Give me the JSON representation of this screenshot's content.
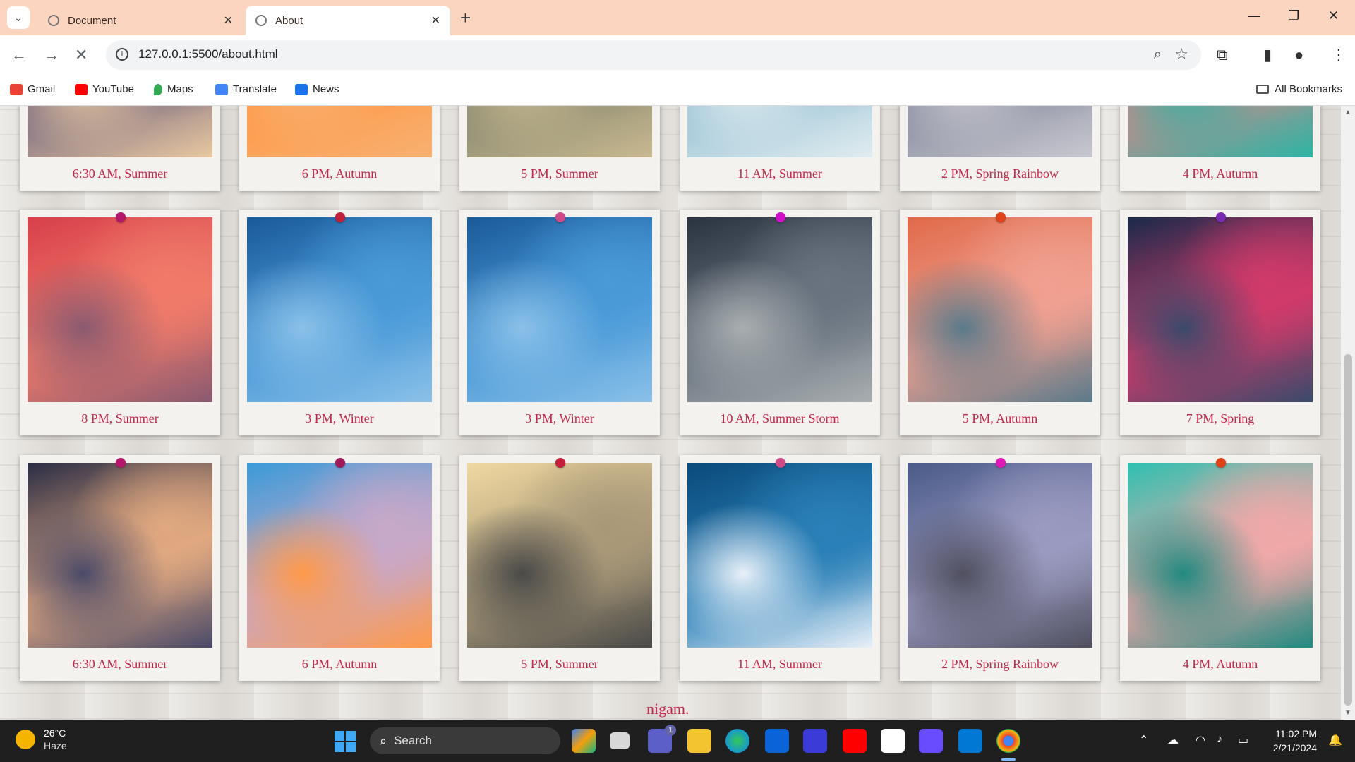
{
  "browser": {
    "tabs": [
      {
        "title": "Document"
      },
      {
        "title": "About"
      }
    ],
    "new_tab_label": "+",
    "address": "127.0.0.1:5500/about.html",
    "bookmarks": [
      {
        "label": "Gmail",
        "color": "#ea4335"
      },
      {
        "label": "YouTube",
        "color": "#ff0000"
      },
      {
        "label": "Maps",
        "color": "#34a853"
      },
      {
        "label": "Translate",
        "color": "#4285f4"
      },
      {
        "label": "News",
        "color": "#1a73e8"
      }
    ],
    "all_bookmarks_label": "All Bookmarks"
  },
  "gallery": {
    "caption_color": "#c0284a",
    "cards": [
      {
        "caption": "6:30 AM, Summer",
        "pin": "#b5186a",
        "sky": [
          "#2a2d45",
          "#7a6a80",
          "#e8c8a0"
        ]
      },
      {
        "caption": "6 PM, Autumn",
        "pin": "#a0195a",
        "sky": [
          "#d88a7a",
          "#ff9a4a",
          "#f7b070"
        ]
      },
      {
        "caption": "5 PM, Summer",
        "pin": "#c41e3a",
        "sky": [
          "#3a4048",
          "#8a8a70",
          "#c8b890"
        ]
      },
      {
        "caption": "11 AM, Summer",
        "pin": "#d04a8a",
        "sky": [
          "#2d6a8e",
          "#9cc4d6",
          "#e0ecf0"
        ]
      },
      {
        "caption": "2 PM, Spring Rainbow",
        "pin": "#e01ab8",
        "sky": [
          "#5a6078",
          "#8a8ea0",
          "#c8c8d0"
        ]
      },
      {
        "caption": "4 PM, Autumn",
        "pin": "#e0421a",
        "sky": [
          "#3aa090",
          "#c88a8a",
          "#2bb5a5"
        ]
      },
      {
        "caption": "8 PM, Summer",
        "pin": "#b5186a",
        "sky": [
          "#d8404a",
          "#f07a6a",
          "#8a5a70"
        ]
      },
      {
        "caption": "3 PM, Winter",
        "pin": "#c41e3a",
        "sky": [
          "#1a5a9a",
          "#4a9ad8",
          "#8ac0e8"
        ]
      },
      {
        "caption": "3 PM, Winter",
        "pin": "#d04a8a",
        "sky": [
          "#1a5a9a",
          "#4a9ad8",
          "#8ac0e8"
        ]
      },
      {
        "caption": "10 AM, Summer Storm",
        "pin": "#d010c8",
        "sky": [
          "#2a3340",
          "#6a7480",
          "#a8aeb0"
        ]
      },
      {
        "caption": "5 PM, Autumn",
        "pin": "#e0421a",
        "sky": [
          "#e06a4a",
          "#f0a090",
          "#5a7a8a"
        ]
      },
      {
        "caption": "7 PM, Spring",
        "pin": "#7a2ab0",
        "sky": [
          "#1a2a4a",
          "#d03a6a",
          "#3a4a6a"
        ]
      },
      {
        "caption": "6:30 AM, Summer",
        "pin": "#b5186a",
        "sky": [
          "#2a2d45",
          "#e0a880",
          "#4a4a68"
        ]
      },
      {
        "caption": "6 PM, Autumn",
        "pin": "#a0195a",
        "sky": [
          "#3a9ad8",
          "#c8a8c8",
          "#ff9a4a"
        ]
      },
      {
        "caption": "5 PM, Summer",
        "pin": "#c41e3a",
        "sky": [
          "#f0d8a0",
          "#a89878",
          "#4a4a48"
        ]
      },
      {
        "caption": "11 AM, Summer",
        "pin": "#d04a8a",
        "sky": [
          "#0a4a7a",
          "#2a80b8",
          "#e8f0f8"
        ]
      },
      {
        "caption": "2 PM, Spring Rainbow",
        "pin": "#e01ab8",
        "sky": [
          "#4a5a88",
          "#9a9ac0",
          "#505060"
        ]
      },
      {
        "caption": "4 PM, Autumn",
        "pin": "#e0421a",
        "sky": [
          "#2ec0b0",
          "#f0a8a8",
          "#208a80"
        ]
      }
    ],
    "footer_text": "nigam."
  },
  "taskbar": {
    "weather_temp": "26°C",
    "weather_condition": "Haze",
    "search_label": "Search",
    "time": "11:02 PM",
    "date": "2/21/2024",
    "teams_badge": "1"
  }
}
